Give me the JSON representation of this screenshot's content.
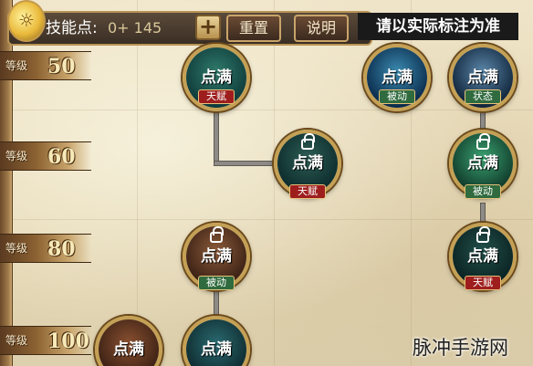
{
  "topbar": {
    "skill_points_label": "技能点:",
    "skill_points_value": "0+ 145",
    "add_label": "+",
    "reset_label": "重置",
    "info_label": "说明"
  },
  "notice": "请以实际标注为准",
  "levels": [
    {
      "word": "等级",
      "num": "50"
    },
    {
      "word": "等级",
      "num": "60"
    },
    {
      "word": "等级",
      "num": "80"
    },
    {
      "word": "等级",
      "num": "100"
    }
  ],
  "nodes": [
    {
      "label": "点满",
      "tag": "天赋",
      "tag_color": "red",
      "bg": [
        "#0f3a3a",
        "#2f7a6a"
      ]
    },
    {
      "label": "点满",
      "tag": "被动",
      "tag_color": "green",
      "bg": [
        "#0a2a4a",
        "#3a8ab0"
      ]
    },
    {
      "label": "点满",
      "tag": "状态",
      "tag_color": "green",
      "bg": [
        "#10243a",
        "#5a86a8"
      ]
    },
    {
      "label": "点满",
      "tag": "天赋",
      "tag_color": "red",
      "bg": [
        "#0c2c2c",
        "#2e5c54"
      ]
    },
    {
      "label": "点满",
      "tag": "被动",
      "tag_color": "green",
      "bg": [
        "#103a2a",
        "#3aa070"
      ]
    },
    {
      "label": "点满",
      "tag": "被动",
      "tag_color": "green",
      "bg": [
        "#3a2014",
        "#8a5a3a"
      ]
    },
    {
      "label": "点满",
      "tag": "天赋",
      "tag_color": "red",
      "bg": [
        "#0a2222",
        "#22504a"
      ]
    },
    {
      "label": "点满",
      "tag": "",
      "tag_color": "red",
      "bg": [
        "#3a2014",
        "#8a5030"
      ]
    },
    {
      "label": "点满",
      "tag": "",
      "tag_color": "green",
      "bg": [
        "#0e2a2e",
        "#2a6a70"
      ]
    }
  ],
  "watermark": "脉冲手游网",
  "colors": {
    "tag_red": "#9e1e1e",
    "tag_green": "#2f6b3e",
    "frame_gold": "#c4a055",
    "notice_bg": "#1a1a1a"
  }
}
